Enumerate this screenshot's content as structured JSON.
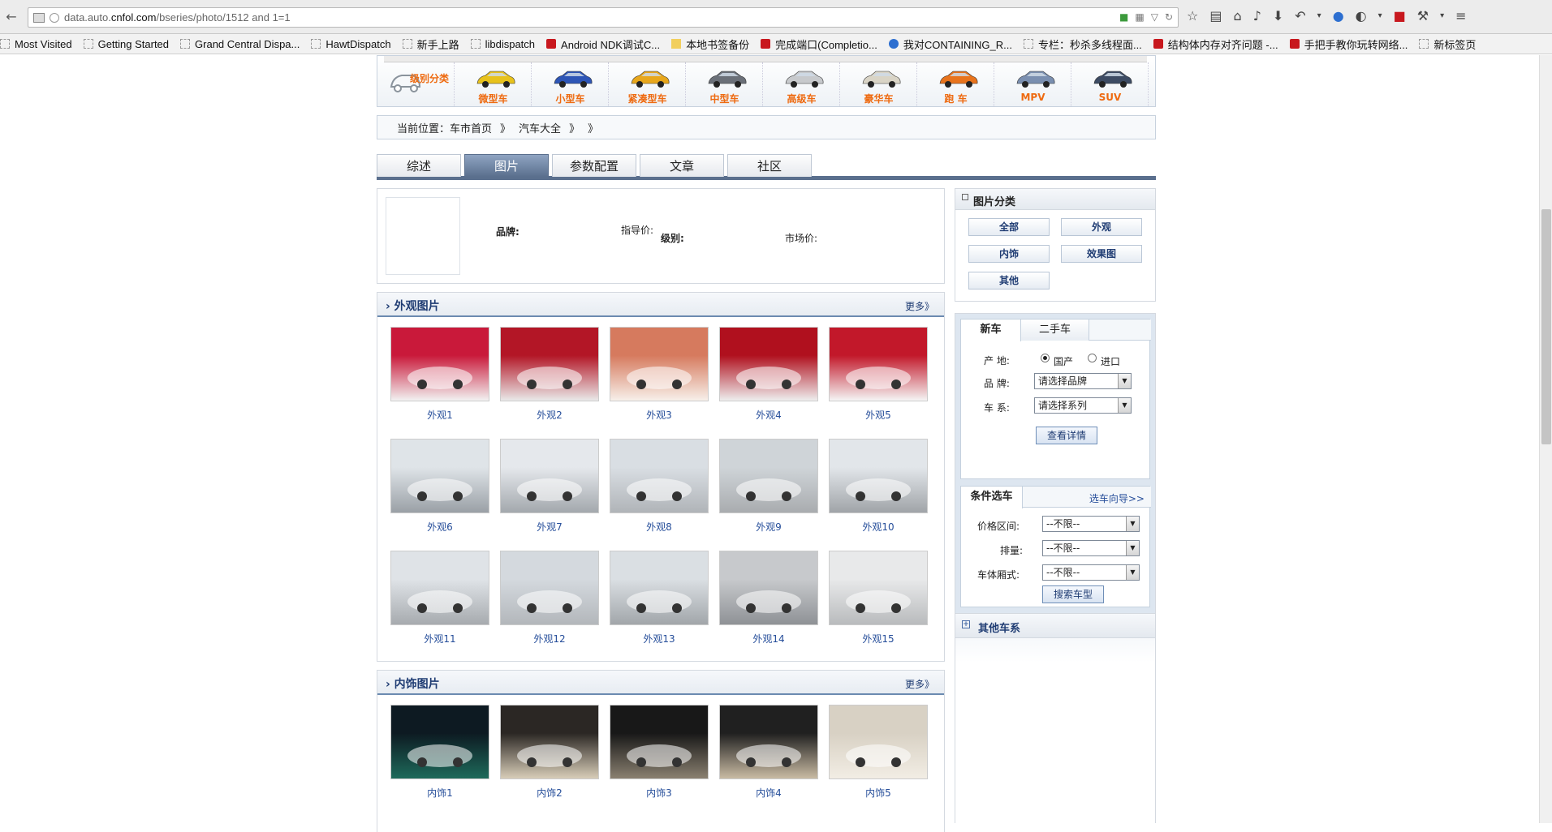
{
  "browser": {
    "url_prefix": "data.auto.",
    "url_domain": "cnfol.com",
    "url_path": "/bseries/photo/1512 and 1=1",
    "bookmarks": [
      {
        "label": "Most Visited",
        "icon": "blank"
      },
      {
        "label": "Getting Started",
        "icon": "blank"
      },
      {
        "label": "Grand Central Dispa...",
        "icon": "blank"
      },
      {
        "label": "HawtDispatch",
        "icon": "blank"
      },
      {
        "label": "新手上路",
        "icon": "blank"
      },
      {
        "label": "libdispatch",
        "icon": "blank"
      },
      {
        "label": "Android NDK调试C...",
        "icon": "red"
      },
      {
        "label": "本地书签备份",
        "icon": "folder"
      },
      {
        "label": "完成端口(Completio...",
        "icon": "red"
      },
      {
        "label": "我对CONTAINING_R...",
        "icon": "blue"
      },
      {
        "label": "专栏：秒杀多线程面...",
        "icon": "blank"
      },
      {
        "label": "结构体内存对齐问题 -...",
        "icon": "red"
      },
      {
        "label": "手把手教你玩转网络...",
        "icon": "red"
      },
      {
        "label": "新标签页",
        "icon": "blank"
      }
    ]
  },
  "categories": [
    {
      "label": "级别分类",
      "color": "#9aa3ad"
    },
    {
      "label": "微型车",
      "color": "#e8c21c"
    },
    {
      "label": "小型车",
      "color": "#2d55b6"
    },
    {
      "label": "紧凑型车",
      "color": "#e8a71c"
    },
    {
      "label": "中型车",
      "color": "#6a6f78"
    },
    {
      "label": "高级车",
      "color": "#c7c9cc"
    },
    {
      "label": "豪华车",
      "color": "#d9d4c6"
    },
    {
      "label": "跑 车",
      "color": "#e8731c"
    },
    {
      "label": "MPV",
      "color": "#7a8fb0"
    },
    {
      "label": "SUV",
      "color": "#3d4b63"
    }
  ],
  "breadcrumb": {
    "prefix": "当前位置：",
    "home": "车市首页",
    "sep1": "》",
    "all": "汽车大全",
    "sep2": "》",
    "sep3": "》"
  },
  "tabs": [
    "综述",
    "图片",
    "参数配置",
    "文章",
    "社区"
  ],
  "info": {
    "brand": "品牌:",
    "guide_price": "指导价:",
    "level": "级别:",
    "market_price": "市场价:"
  },
  "exterior": {
    "title": "外观图片",
    "more": "更多》",
    "photos": [
      {
        "caption": "外观1",
        "c1": "#c9193a",
        "c2": "#f2f2f2"
      },
      {
        "caption": "外观2",
        "c1": "#b31626",
        "c2": "#e9e9e9"
      },
      {
        "caption": "外观3",
        "c1": "#d67a5e",
        "c2": "#f7f0ea"
      },
      {
        "caption": "外观4",
        "c1": "#b0101e",
        "c2": "#eeeeee"
      },
      {
        "caption": "外观5",
        "c1": "#c2182a",
        "c2": "#f5f5f5"
      },
      {
        "caption": "外观6",
        "c1": "#dfe4e8",
        "c2": "#9aa0a6"
      },
      {
        "caption": "外观7",
        "c1": "#e5e8ec",
        "c2": "#a3a8ad"
      },
      {
        "caption": "外观8",
        "c1": "#d9dee3",
        "c2": "#b0b4b8"
      },
      {
        "caption": "外观9",
        "c1": "#cfd4d8",
        "c2": "#a9acaf"
      },
      {
        "caption": "外观10",
        "c1": "#e2e6ea",
        "c2": "#a0a4a8"
      },
      {
        "caption": "外观11",
        "c1": "#dfe3e7",
        "c2": "#a7abaf"
      },
      {
        "caption": "外观12",
        "c1": "#d4d9de",
        "c2": "#b3b7bb"
      },
      {
        "caption": "外观13",
        "c1": "#dadfe3",
        "c2": "#a2a6aa"
      },
      {
        "caption": "外观14",
        "c1": "#c7c9cc",
        "c2": "#8f9296"
      },
      {
        "caption": "外观15",
        "c1": "#e8e9ea",
        "c2": "#b9bbbd"
      }
    ]
  },
  "interior": {
    "title": "内饰图片",
    "more": "更多》",
    "photos": [
      {
        "caption": "内饰1",
        "c1": "#0d1a22",
        "c2": "#1e6a5a"
      },
      {
        "caption": "内饰2",
        "c1": "#2b2724",
        "c2": "#d8cdb8"
      },
      {
        "caption": "内饰3",
        "c1": "#181818",
        "c2": "#8a8070"
      },
      {
        "caption": "内饰4",
        "c1": "#202020",
        "c2": "#c9bba3"
      },
      {
        "caption": "内饰5",
        "c1": "#d8d1c4",
        "c2": "#f2ede4"
      }
    ]
  },
  "sidebar": {
    "photo_category": {
      "title": "图片分类",
      "buttons": [
        "全部",
        "外观",
        "内饰",
        "效果图",
        "其他"
      ]
    },
    "car_search": {
      "tab_new": "新车",
      "tab_used": "二手车",
      "origin_label": "产 地:",
      "origin_domestic": "国产",
      "origin_import": "进口",
      "brand_label": "品 牌:",
      "brand_placeholder": "请选择品牌",
      "series_label": "车 系:",
      "series_placeholder": "请选择系列",
      "detail_button": "查看详情"
    },
    "condition": {
      "title": "条件选车",
      "guide": "选车向导>>",
      "price_label": "价格区间:",
      "price_value": "--不限--",
      "displacement_label": "排量:",
      "displacement_value": "--不限--",
      "body_label": "车体厢式:",
      "body_value": "--不限--",
      "search_button": "搜索车型"
    },
    "other_series": {
      "title": "其他车系"
    }
  }
}
